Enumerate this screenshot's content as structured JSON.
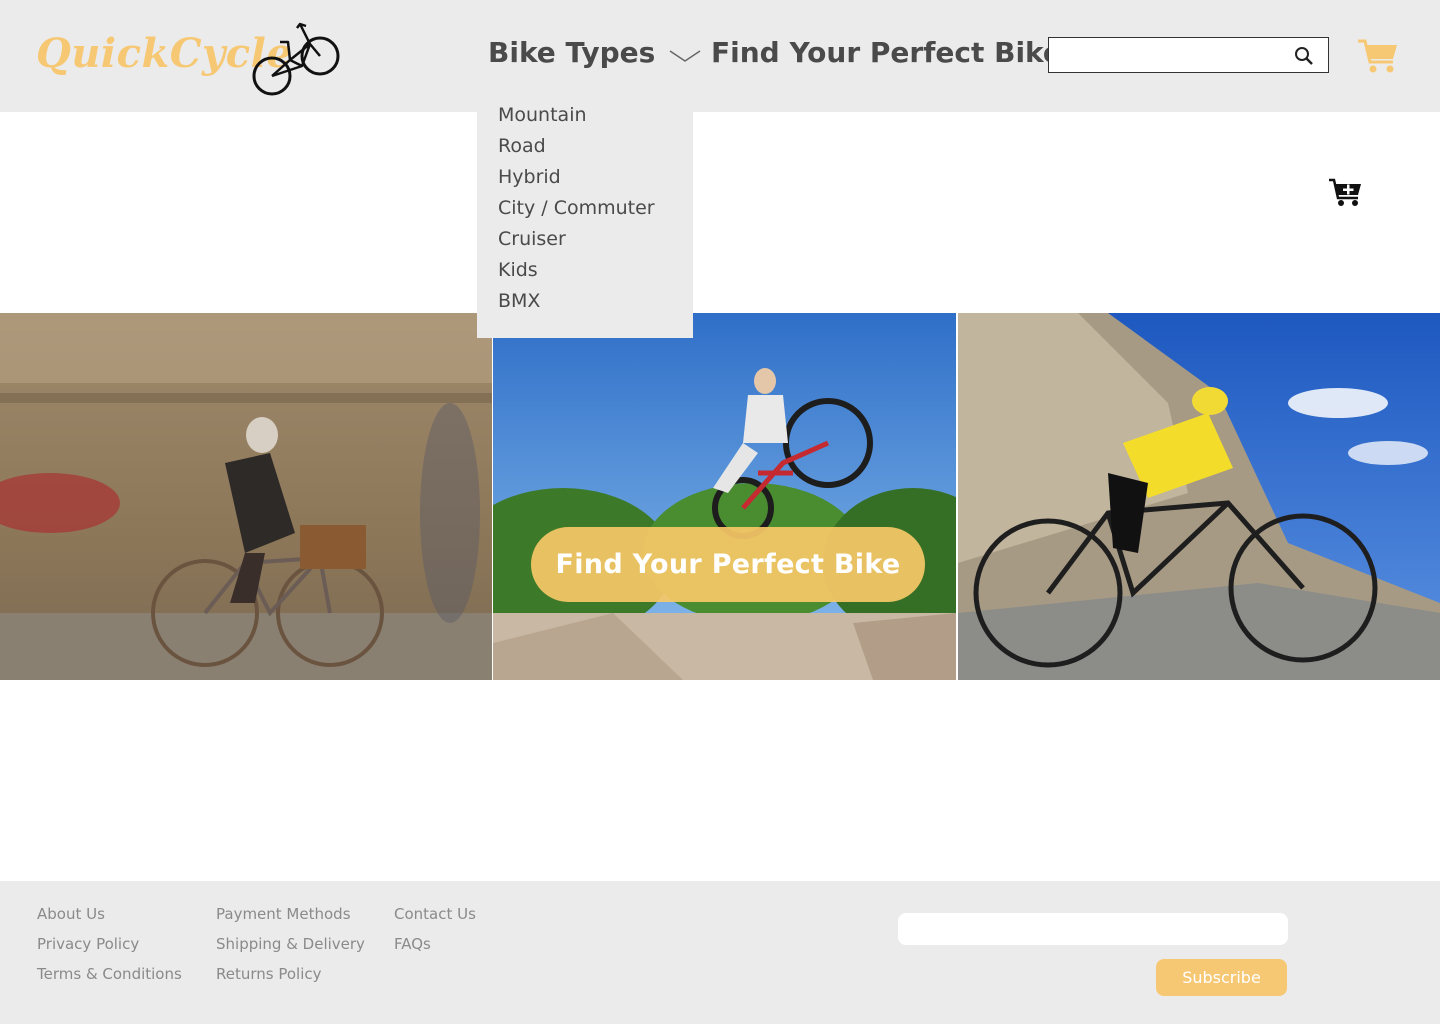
{
  "brand": {
    "name": "QuickCycle"
  },
  "nav": {
    "bike_types": "Bike Types",
    "find_bike": "Find Your Perfect Bike"
  },
  "search": {
    "placeholder": ""
  },
  "dropdown": {
    "items": [
      "Mountain",
      "Road",
      "Hybrid",
      "City / Commuter",
      "Cruiser",
      "Kids",
      "BMX"
    ]
  },
  "hero": {
    "cta_label": "Find Your Perfect Bike"
  },
  "footer": {
    "col1": [
      "About Us",
      "Privacy Policy",
      "Terms & Conditions"
    ],
    "col2": [
      "Payment Methods",
      "Shipping & Delivery",
      "Returns Policy"
    ],
    "col3": [
      "Contact Us",
      "FAQs"
    ],
    "email_placeholder": "",
    "subscribe_label": "Subscribe"
  },
  "colors": {
    "accent": "#f7c873",
    "header_bg": "#ebebeb",
    "text": "#4a4a4a",
    "footer_text": "#8a8a8a"
  },
  "icons": [
    "bicycle-logo-icon",
    "chevron-down-icon",
    "search-icon",
    "cart-icon",
    "add-to-cart-icon"
  ]
}
